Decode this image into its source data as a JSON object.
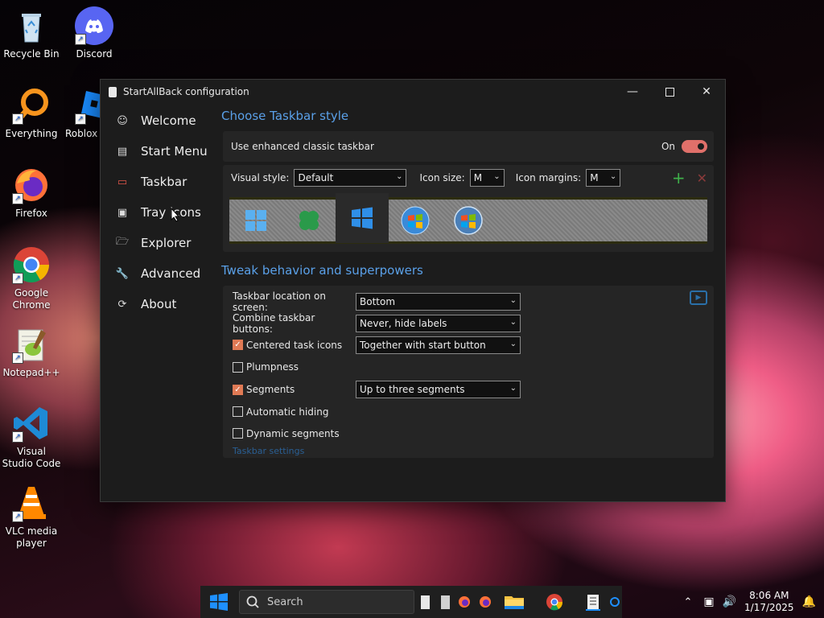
{
  "desktop": {
    "icons": [
      {
        "label": "Recycle Bin"
      },
      {
        "label": "Discord"
      },
      {
        "label": "Everything"
      },
      {
        "label": "Roblox S"
      },
      {
        "label": "Firefox"
      },
      {
        "label": "Google Chrome"
      },
      {
        "label": "Notepad++"
      },
      {
        "label": "Visual Studio Code"
      },
      {
        "label": "VLC media player"
      }
    ]
  },
  "window": {
    "title": "StartAllBack configuration",
    "sidebar": {
      "items": [
        {
          "label": "Welcome",
          "icon": "smile-icon"
        },
        {
          "label": "Start Menu",
          "icon": "start-menu-icon"
        },
        {
          "label": "Taskbar",
          "icon": "taskbar-icon",
          "active": true
        },
        {
          "label": "Tray icons",
          "icon": "tray-icon"
        },
        {
          "label": "Explorer",
          "icon": "folder-icon"
        },
        {
          "label": "Advanced",
          "icon": "wrench-icon"
        },
        {
          "label": "About",
          "icon": "about-icon"
        }
      ]
    },
    "taskbar_style": {
      "heading": "Choose Taskbar style",
      "enhanced_label": "Use enhanced classic taskbar",
      "enhanced_state": "On",
      "visual_style_label": "Visual style:",
      "visual_style_value": "Default",
      "icon_size_label": "Icon size:",
      "icon_size_value": "M",
      "icon_margins_label": "Icon margins:",
      "icon_margins_value": "M"
    },
    "tweaks": {
      "heading": "Tweak behavior and superpowers",
      "location_label": "Taskbar location on screen:",
      "location_value": "Bottom",
      "combine_label": "Combine taskbar buttons:",
      "combine_value": "Never, hide labels",
      "centered_label": "Centered task icons",
      "centered_checked": true,
      "centered_value": "Together with start button",
      "plumpness_label": "Plumpness",
      "plumpness_checked": false,
      "segments_label": "Segments",
      "segments_checked": true,
      "segments_value": "Up to three segments",
      "autohide_label": "Automatic hiding",
      "autohide_checked": false,
      "dynamic_label": "Dynamic segments",
      "dynamic_checked": false,
      "settings_link": "Taskbar settings"
    }
  },
  "taskbar": {
    "search_label": "Search",
    "time": "8:06 AM",
    "date": "1/17/2025"
  },
  "colors": {
    "accent_blue": "#5aa0e8",
    "toggle_on": "#e0706a",
    "check_on": "#e07a55",
    "active_nav": "#e0564a"
  }
}
